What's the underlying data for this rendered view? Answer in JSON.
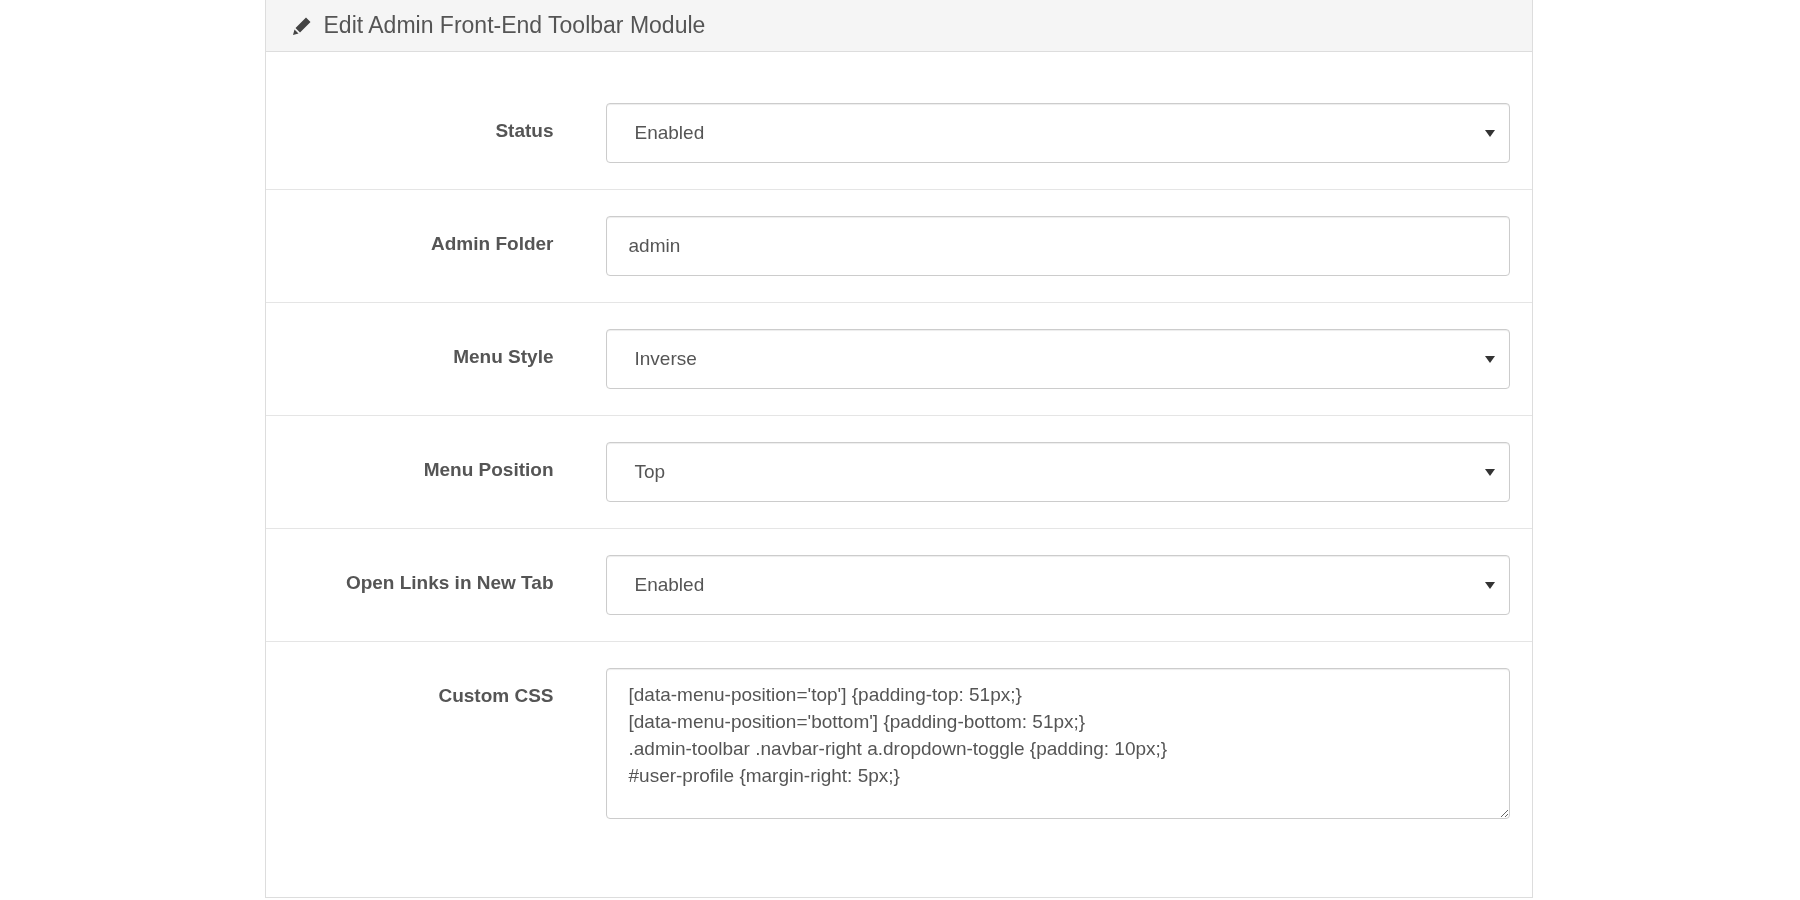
{
  "panel": {
    "title": "Edit Admin Front-End Toolbar Module"
  },
  "fields": [
    {
      "kind": "select",
      "label": "Status",
      "value": "Enabled"
    },
    {
      "kind": "text",
      "label": "Admin Folder",
      "value": "admin"
    },
    {
      "kind": "select",
      "label": "Menu Style",
      "value": "Inverse"
    },
    {
      "kind": "select",
      "label": "Menu Position",
      "value": "Top"
    },
    {
      "kind": "select",
      "label": "Open Links in New Tab",
      "value": "Enabled"
    },
    {
      "kind": "textarea",
      "label": "Custom CSS",
      "value": "[data-menu-position='top'] {padding-top: 51px;}\n[data-menu-position='bottom'] {padding-bottom: 51px;}\n.admin-toolbar .navbar-right a.dropdown-toggle {padding: 10px;}\n#user-profile {margin-right: 5px;}"
    }
  ]
}
